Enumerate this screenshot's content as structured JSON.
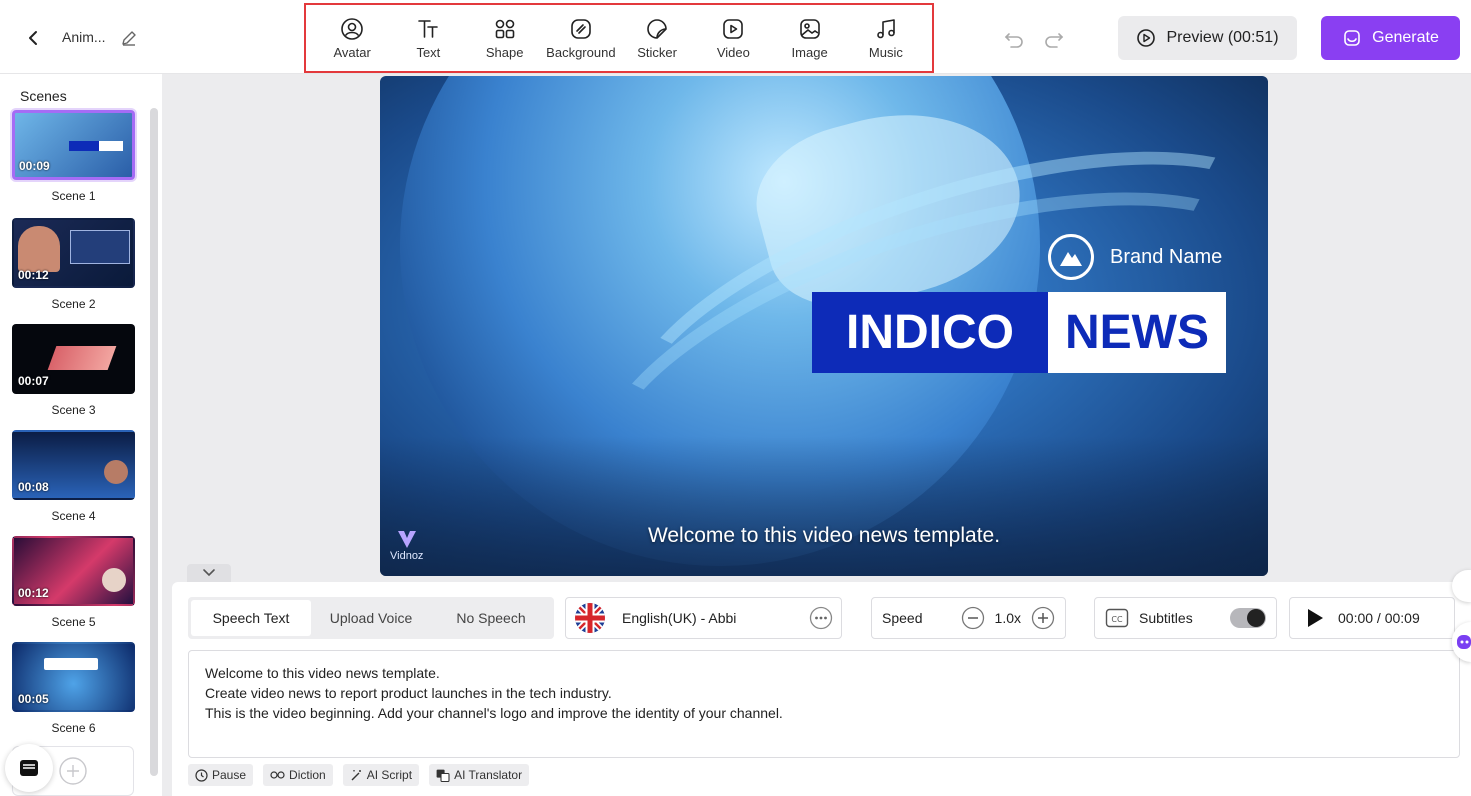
{
  "header": {
    "project_title": "Anim...",
    "tools": [
      {
        "label": "Avatar",
        "icon": "avatar-icon"
      },
      {
        "label": "Text",
        "icon": "text-icon"
      },
      {
        "label": "Shape",
        "icon": "shape-icon"
      },
      {
        "label": "Background",
        "icon": "background-icon"
      },
      {
        "label": "Sticker",
        "icon": "sticker-icon"
      },
      {
        "label": "Video",
        "icon": "video-icon"
      },
      {
        "label": "Image",
        "icon": "image-icon"
      },
      {
        "label": "Music",
        "icon": "music-icon"
      }
    ],
    "preview_label": "Preview (00:51)",
    "generate_label": "Generate",
    "colors": {
      "accent": "#8a3ff2",
      "highlight_border": "#e3393c"
    }
  },
  "sidebar": {
    "title": "Scenes",
    "scenes": [
      {
        "name": "Scene 1",
        "duration": "00:09",
        "active": true
      },
      {
        "name": "Scene 2",
        "duration": "00:12",
        "active": false
      },
      {
        "name": "Scene 3",
        "duration": "00:07",
        "active": false
      },
      {
        "name": "Scene 4",
        "duration": "00:08",
        "active": false
      },
      {
        "name": "Scene 5",
        "duration": "00:12",
        "active": false
      },
      {
        "name": "Scene 6",
        "duration": "00:05",
        "active": false
      }
    ]
  },
  "canvas": {
    "brand_name": "Brand Name",
    "title_left": "INDICO",
    "title_right": "NEWS",
    "subtitle": "Welcome to this video news template.",
    "watermark": "Vidnoz",
    "colors": {
      "title_blue": "#0d2bb8"
    }
  },
  "panel": {
    "tabs": [
      "Speech Text",
      "Upload Voice",
      "No Speech"
    ],
    "active_tab": "Speech Text",
    "voice": "English(UK) - Abbi",
    "speed_label": "Speed",
    "speed_value": "1.0x",
    "subtitles_label": "Subtitles",
    "playback_time": "00:00 / 00:09",
    "script_lines": [
      "Welcome to this video news template.",
      "Create video news to report product launches in the tech industry.",
      "This is the video beginning. Add your channel's logo and improve the identity of your channel."
    ],
    "tools": [
      {
        "label": "Pause",
        "icon": "clock-icon"
      },
      {
        "label": "Diction",
        "icon": "glasses-icon"
      },
      {
        "label": "AI Script",
        "icon": "magic-wand-icon"
      },
      {
        "label": "AI Translator",
        "icon": "translate-icon"
      }
    ]
  }
}
